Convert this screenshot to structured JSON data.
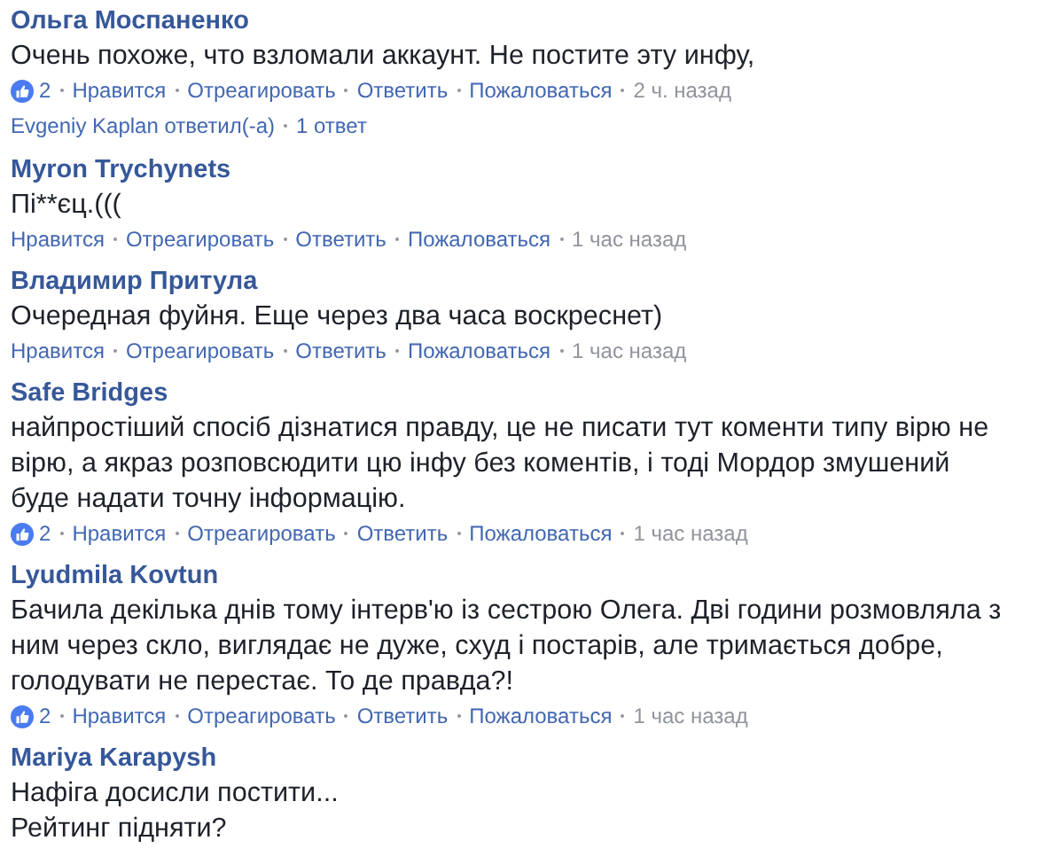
{
  "comments": [
    {
      "author": "Ольга Моспаненко",
      "text": "Очень похоже, что взломали аккаунт. Не постите эту инфу,",
      "likes": "2",
      "actions": [
        "Нравится",
        "Отреагировать",
        "Ответить",
        "Пожаловаться"
      ],
      "time": "2 ч. назад",
      "replies": {
        "who": "Evgeniy Kaplan ответил(-а)",
        "count": "1 ответ"
      }
    },
    {
      "author": "Myron Trychynets",
      "text": "Пі**єц.(((",
      "actions": [
        "Нравится",
        "Отреагировать",
        "Ответить",
        "Пожаловаться"
      ],
      "time": "1 час назад"
    },
    {
      "author": "Владимир Притула",
      "text": "Очередная фуйня. Еще через два часа воскреснет)",
      "actions": [
        "Нравится",
        "Отреагировать",
        "Ответить",
        "Пожаловаться"
      ],
      "time": "1 час назад"
    },
    {
      "author": "Safe Bridges",
      "text": "найпростіший спосіб дізнатися правду, це не писати тут коменти типу вірю не вірю, а якраз розповсюдити цю інфу без коментів, і тоді Мордор змушений буде надати точну інформацію.",
      "likes": "2",
      "actions": [
        "Нравится",
        "Отреагировать",
        "Ответить",
        "Пожаловаться"
      ],
      "time": "1 час назад"
    },
    {
      "author": "Lyudmila Kovtun",
      "text": "Бачила декілька днів тому інтерв'ю із сестрою Олега. Дві години розмовляла з ним через скло, виглядає не дуже, схуд і постарів, але тримається добре, голодувати не перестає. То де правда?!",
      "likes": "2",
      "actions": [
        "Нравится",
        "Отреагировать",
        "Ответить",
        "Пожаловаться"
      ],
      "time": "1 час назад"
    },
    {
      "author": "Mariya Karapysh",
      "text": "Нафіга досисли постити...\nРейтинг підняти?"
    }
  ]
}
